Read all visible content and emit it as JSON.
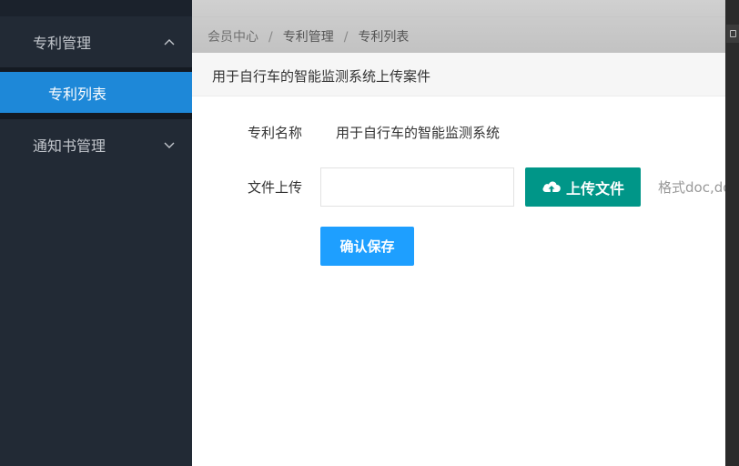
{
  "sidebar": {
    "group1": {
      "label": "专利管理",
      "icon": "chevron-up-icon"
    },
    "submenu": {
      "label": "专利列表"
    },
    "group2": {
      "label": "通知书管理",
      "icon": "chevron-down-icon"
    }
  },
  "breadcrumb": {
    "items": [
      "会员中心",
      "专利管理",
      "专利列表"
    ],
    "separator": "/"
  },
  "panel": {
    "title": "用于自行车的智能监测系统上传案件"
  },
  "form": {
    "name_label": "专利名称",
    "name_value": "用于自行车的智能监测系统",
    "file_label": "文件上传",
    "file_value": "",
    "upload_label": "上传文件",
    "upload_icon": "cloud-upload-icon",
    "format_hint": "格式doc,do",
    "save_label": "确认保存"
  },
  "colors": {
    "sidebar_bg": "#222a35",
    "active_item": "#1e88d8",
    "upload_button": "#009688",
    "save_button": "#1e9fff"
  }
}
